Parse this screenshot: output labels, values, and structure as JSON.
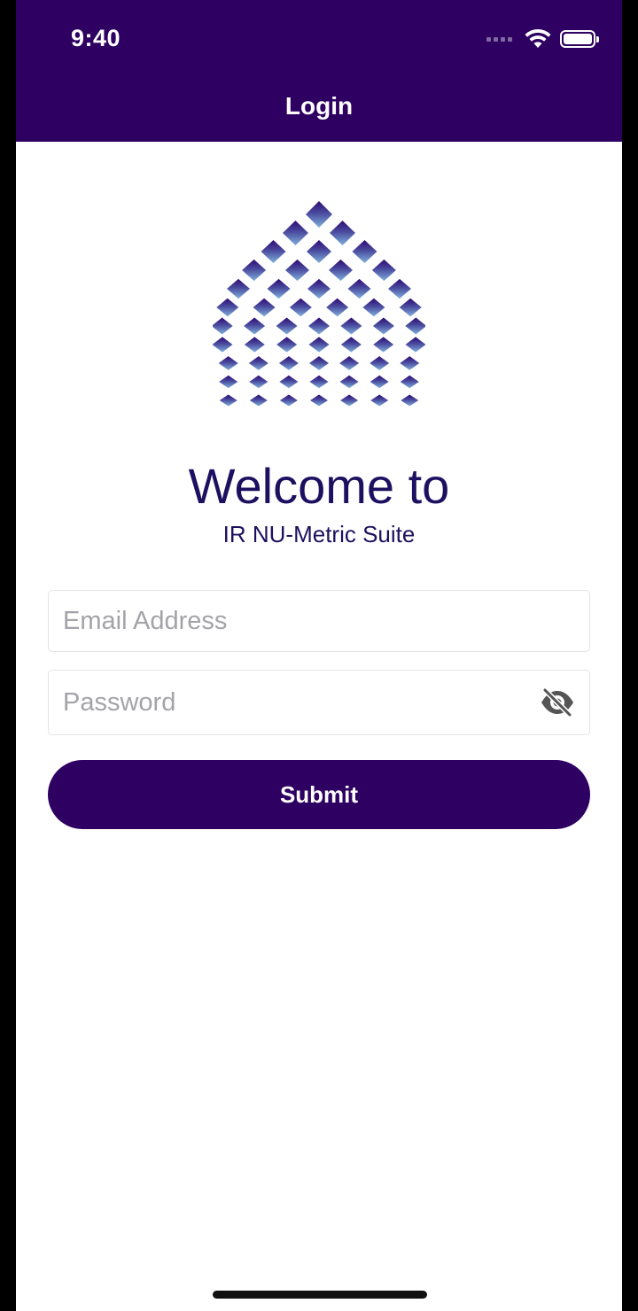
{
  "status_bar": {
    "time": "9:40",
    "icons": [
      "cellular-signal-icon",
      "wifi-icon",
      "battery-icon"
    ]
  },
  "nav": {
    "title": "Login"
  },
  "brand": {
    "logo_icon": "droplet-diamond-logo-icon",
    "welcome": "Welcome to",
    "suite_name": "IR NU-Metric Suite"
  },
  "form": {
    "email": {
      "value": "",
      "placeholder": "Email Address"
    },
    "password": {
      "value": "",
      "placeholder": "Password",
      "toggle_icon": "eye-off-icon"
    },
    "submit_label": "Submit"
  },
  "colors": {
    "primary": "#2e0061",
    "text_dark": "#1e1060",
    "logo_top": "#2e0a73",
    "logo_bottom": "#7fb0dc",
    "placeholder": "#a3a3a8"
  }
}
